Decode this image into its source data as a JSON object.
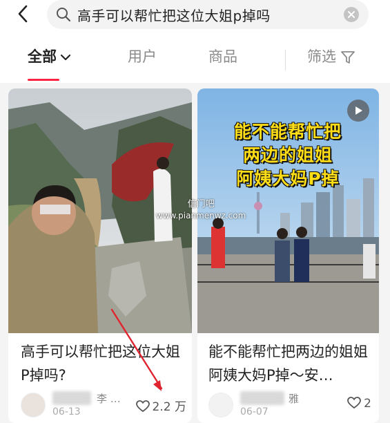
{
  "search": {
    "query": "高手可以帮忙把这位大姐p掉吗"
  },
  "tabs": [
    {
      "label": "全部",
      "active": true
    },
    {
      "label": "用户"
    },
    {
      "label": "商品"
    },
    {
      "label": "筛选"
    }
  ],
  "watermark": {
    "line1": "信门吧",
    "line2": "www.pianmenwz.com"
  },
  "cards": [
    {
      "title": "高手可以帮忙把这位大姐P掉吗?",
      "author": "李 …",
      "date": "06-13",
      "likes": "2.2 万"
    },
    {
      "title": "能不能帮忙把两边的姐姐阿姨大妈P掉～安…",
      "author": "雅",
      "date": "06-07",
      "likes": "2",
      "image_caption": [
        "能不能帮忙把",
        "两边的姐姐",
        "阿姨大妈P掉"
      ]
    }
  ],
  "colors": {
    "accent": "#ff2442",
    "caption": "#ffde17"
  }
}
